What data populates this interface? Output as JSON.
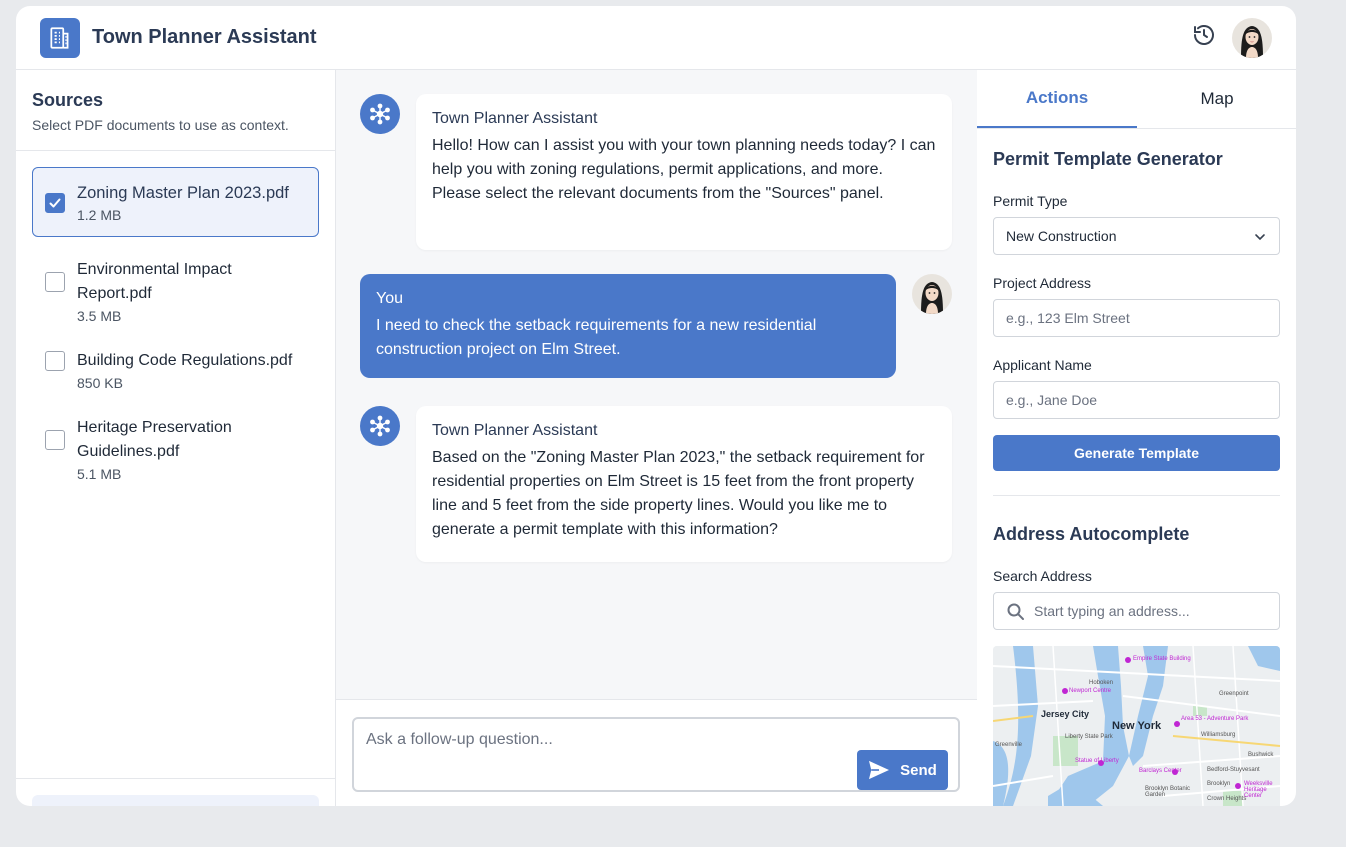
{
  "header": {
    "title": "Town Planner Assistant"
  },
  "sources": {
    "title": "Sources",
    "subtitle": "Select PDF documents to use as context.",
    "files": [
      {
        "name": "Zoning Master Plan 2023.pdf",
        "size": "1.2 MB",
        "checked": true
      },
      {
        "name": "Environmental Impact Report.pdf",
        "size": "3.5 MB",
        "checked": false
      },
      {
        "name": "Building Code Regulations.pdf",
        "size": "850 KB",
        "checked": false
      },
      {
        "name": "Heritage Preservation Guidelines.pdf",
        "size": "5.1 MB",
        "checked": false
      }
    ]
  },
  "chat": {
    "messages": [
      {
        "sender": "Town Planner Assistant",
        "role": "assistant",
        "text": "Hello! How can I assist you with your town planning needs today? I can help you with zoning regulations, permit applications, and more. Please select the relevant documents from the \"Sources\" panel."
      },
      {
        "sender": "You",
        "role": "user",
        "text": "I need to check the setback requirements for a new residential construction project on Elm Street."
      },
      {
        "sender": "Town Planner Assistant",
        "role": "assistant",
        "text": "Based on the \"Zoning Master Plan 2023,\" the setback requirement for residential properties on Elm Street is 15 feet from the front property line and 5 feet from the side property lines. Would you like me to generate a permit template with this information?"
      }
    ],
    "composer_placeholder": "Ask a follow-up question...",
    "send_label": "Send"
  },
  "right": {
    "tabs": [
      {
        "label": "Actions",
        "active": true
      },
      {
        "label": "Map",
        "active": false
      }
    ],
    "permit": {
      "title": "Permit Template Generator",
      "type_label": "Permit Type",
      "type_value": "New Construction",
      "address_label": "Project Address",
      "address_placeholder": "e.g., 123 Elm Street",
      "applicant_label": "Applicant Name",
      "applicant_placeholder": "e.g., Jane Doe",
      "button": "Generate Template"
    },
    "autocomplete": {
      "title": "Address Autocomplete",
      "search_label": "Search Address",
      "search_placeholder": "Start typing an address..."
    },
    "map": {
      "labels": [
        "New York",
        "Jersey City",
        "Hoboken",
        "Empire State Building",
        "Liberty State Park",
        "Statue of Liberty",
        "Barclays Center",
        "Brooklyn",
        "Area 53 - Adventure Park",
        "Williamsburg",
        "Greenpoint",
        "Bedford-Stuyvesant",
        "Bushwick",
        "Crown Heights",
        "Weeksville Heritage Center",
        "Brooklyn Botanic Garden",
        "Greenville",
        "Newport Centre"
      ]
    }
  },
  "colors": {
    "accent": "#4a78c9",
    "title": "#2b3a55",
    "chat_bg": "#f6f7f9"
  }
}
